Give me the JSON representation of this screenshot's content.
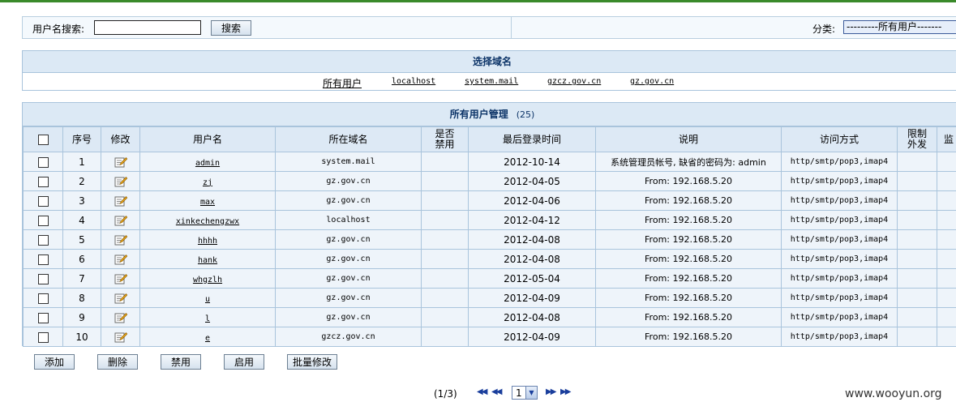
{
  "search": {
    "label": "用户名搜索:",
    "input_value": "",
    "button": "搜索",
    "category_label": "分类:",
    "category_selected": "---------所有用户-------"
  },
  "domain_panel": {
    "title": "选择域名",
    "links": [
      "所有用户",
      "localhost",
      "system.mail",
      "gzcz.gov.cn",
      "gz.gov.cn"
    ]
  },
  "user_panel": {
    "title": "所有用户管理",
    "count": "(25)",
    "columns": [
      "",
      "序号",
      "修改",
      "用户名",
      "所在域名",
      "是否禁用",
      "最后登录时间",
      "说明",
      "访问方式",
      "限制外发",
      "监"
    ],
    "rows": [
      {
        "no": "1",
        "user": "admin",
        "domain": "system.mail",
        "disabled": "",
        "last_login": "2012-10-14",
        "desc": "系统管理员帐号, 缺省的密码为: admin",
        "access": "http/smtp/pop3,imap4",
        "limit": ""
      },
      {
        "no": "2",
        "user": "zj",
        "domain": "gz.gov.cn",
        "disabled": "",
        "last_login": "2012-04-05",
        "desc": "From: 192.168.5.20",
        "access": "http/smtp/pop3,imap4",
        "limit": ""
      },
      {
        "no": "3",
        "user": "max",
        "domain": "gz.gov.cn",
        "disabled": "",
        "last_login": "2012-04-06",
        "desc": "From: 192.168.5.20",
        "access": "http/smtp/pop3,imap4",
        "limit": ""
      },
      {
        "no": "4",
        "user": "xinkechengzwx",
        "domain": "localhost",
        "disabled": "",
        "last_login": "2012-04-12",
        "desc": "From: 192.168.5.20",
        "access": "http/smtp/pop3,imap4",
        "limit": ""
      },
      {
        "no": "5",
        "user": "hhhh",
        "domain": "gz.gov.cn",
        "disabled": "",
        "last_login": "2012-04-08",
        "desc": "From: 192.168.5.20",
        "access": "http/smtp/pop3,imap4",
        "limit": ""
      },
      {
        "no": "6",
        "user": "hank",
        "domain": "gz.gov.cn",
        "disabled": "",
        "last_login": "2012-04-08",
        "desc": "From: 192.168.5.20",
        "access": "http/smtp/pop3,imap4",
        "limit": ""
      },
      {
        "no": "7",
        "user": "whgzlh",
        "domain": "gz.gov.cn",
        "disabled": "",
        "last_login": "2012-05-04",
        "desc": "From: 192.168.5.20",
        "access": "http/smtp/pop3,imap4",
        "limit": ""
      },
      {
        "no": "8",
        "user": "u",
        "domain": "gz.gov.cn",
        "disabled": "",
        "last_login": "2012-04-09",
        "desc": "From: 192.168.5.20",
        "access": "http/smtp/pop3,imap4",
        "limit": ""
      },
      {
        "no": "9",
        "user": "l",
        "domain": "gz.gov.cn",
        "disabled": "",
        "last_login": "2012-04-08",
        "desc": "From: 192.168.5.20",
        "access": "http/smtp/pop3,imap4",
        "limit": ""
      },
      {
        "no": "10",
        "user": "e",
        "domain": "gzcz.gov.cn",
        "disabled": "",
        "last_login": "2012-04-09",
        "desc": "From: 192.168.5.20",
        "access": "http/smtp/pop3,imap4",
        "limit": ""
      }
    ]
  },
  "actions": {
    "add": "添加",
    "delete": "删除",
    "disable": "禁用",
    "enable": "启用",
    "batch_edit": "批量修改"
  },
  "pagination": {
    "info": "(1/3)",
    "current_page": "1"
  },
  "watermark": "www.wooyun.org",
  "colors": {
    "panel_header_bg": "#dce9f5",
    "row_bg": "#eef4fa",
    "border": "#a9c4dc",
    "title_text": "#0c3468",
    "top_accent": "#3a8a2a"
  }
}
